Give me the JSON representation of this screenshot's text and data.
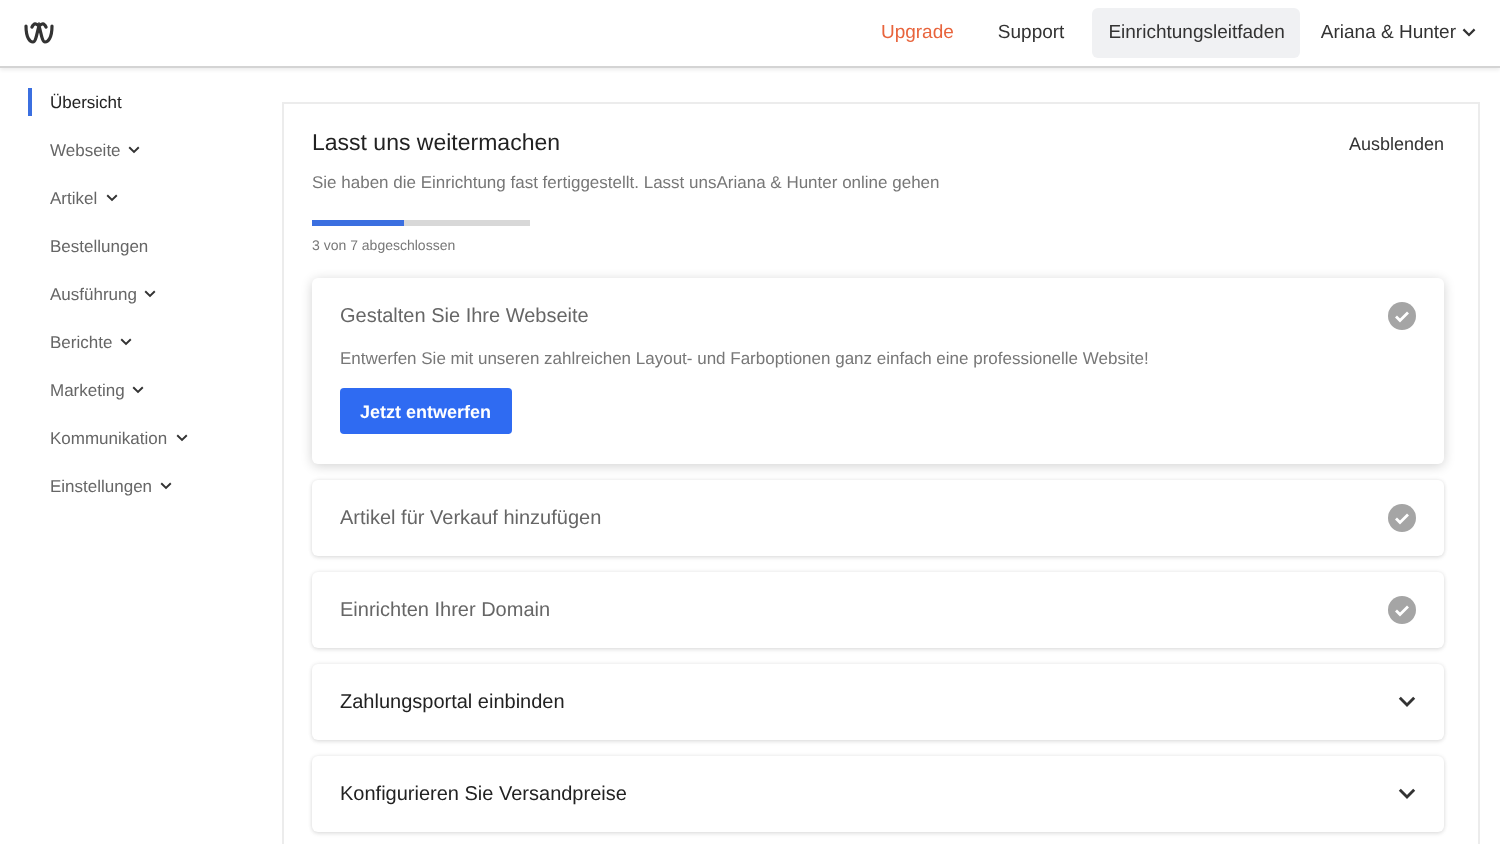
{
  "header": {
    "links": [
      {
        "label": "Upgrade",
        "kind": "upgrade",
        "selected": false
      },
      {
        "label": "Support",
        "kind": "plain",
        "selected": false
      },
      {
        "label": "Einrichtungsleitfaden",
        "kind": "plain",
        "selected": true
      }
    ],
    "account": "Ariana & Hunter"
  },
  "sidebar": {
    "items": [
      {
        "label": "Übersicht",
        "selected": true,
        "expandable": false
      },
      {
        "label": "Webseite",
        "selected": false,
        "expandable": true
      },
      {
        "label": "Artikel",
        "selected": false,
        "expandable": true
      },
      {
        "label": "Bestellungen",
        "selected": false,
        "expandable": false
      },
      {
        "label": "Ausführung",
        "selected": false,
        "expandable": true
      },
      {
        "label": "Berichte",
        "selected": false,
        "expandable": true
      },
      {
        "label": "Marketing",
        "selected": false,
        "expandable": true
      },
      {
        "label": "Kommunikation",
        "selected": false,
        "expandable": true
      },
      {
        "label": "Einstellungen",
        "selected": false,
        "expandable": true
      }
    ]
  },
  "setup": {
    "title": "Lasst uns weitermachen",
    "hide_label": "Ausblenden",
    "subtitle": "Sie haben die Einrichtung fast fertiggestellt. Lasst unsAriana & Hunter online gehen",
    "progress": {
      "level": 0.42,
      "label": "3 von 7 abgeschlossen"
    },
    "tasks": [
      {
        "title": "Gestalten Sie Ihre Webseite",
        "done": true,
        "expanded": true,
        "description": "Entwerfen Sie mit unseren zahlreichen Layout- und Farboptionen ganz einfach eine professionelle Website!",
        "button": "Jetzt entwerfen"
      },
      {
        "title": "Artikel für Verkauf hinzufügen",
        "done": true,
        "expanded": false
      },
      {
        "title": "Einrichten Ihrer Domain",
        "done": true,
        "expanded": false
      },
      {
        "title": "Zahlungsportal einbinden",
        "done": false,
        "expanded": false
      },
      {
        "title": "Konfigurieren Sie Versandpreise",
        "done": false,
        "expanded": false
      }
    ]
  }
}
